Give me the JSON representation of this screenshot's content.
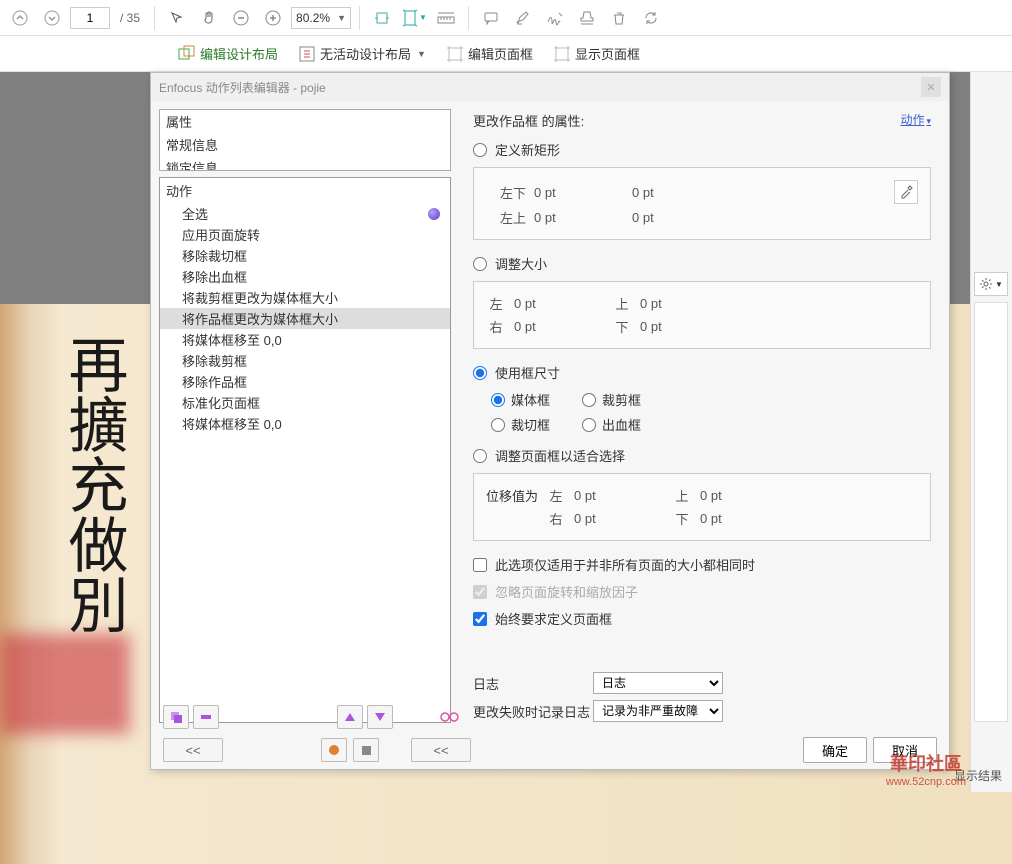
{
  "toolbar": {
    "page_current": "1",
    "page_total": "/ 35",
    "zoom": "80.2%"
  },
  "secondbar": {
    "edit_layout": "编辑设计布局",
    "no_active": "无活动设计布局",
    "edit_frame": "编辑页面框",
    "show_frame": "显示页面框"
  },
  "dialog": {
    "title": "Enfocus 动作列表编辑器 - pojie",
    "properties": [
      "属性",
      "常规信息",
      "锁定信息"
    ],
    "action_header": "动作",
    "actions": [
      "全选",
      "应用页面旋转",
      "移除裁切框",
      "移除出血框",
      "将裁剪框更改为媒体框大小",
      "将作品框更改为媒体框大小",
      "将媒体框移至 0,0",
      "移除裁剪框",
      "移除作品框",
      "标准化页面框",
      "将媒体框移至 0,0"
    ],
    "selected_action": 5,
    "right": {
      "section_title": "更改作品框 的属性:",
      "action_link": "动作",
      "opt_define": "定义新矩形",
      "left_bottom": "左下",
      "lb_val": "0 pt",
      "lb_val2": "0 pt",
      "left_top": "左上",
      "lt_val": "0 pt",
      "lt_val2": "0 pt",
      "opt_resize": "调整大小",
      "left": "左",
      "l_val": "0 pt",
      "top": "上",
      "t_val": "0 pt",
      "right_lbl": "右",
      "r_val": "0 pt",
      "bottom": "下",
      "b_val": "0 pt",
      "opt_useframe": "使用框尺寸",
      "media_frame": "媒体框",
      "crop_frame": "裁剪框",
      "trim_frame": "裁切框",
      "bleed_frame": "出血框",
      "opt_adjust": "调整页面框以适合选择",
      "offset_label": "位移值为",
      "off_left": "左",
      "off_l_val": "0 pt",
      "off_top": "上",
      "off_t_val": "0 pt",
      "off_right": "右",
      "off_r_val": "0 pt",
      "off_bottom": "下",
      "off_b_val": "0 pt",
      "chk_diff": "此选项仅适用于并非所有页面的大小都相同时",
      "chk_ignore": "忽略页面旋转和缩放因子",
      "chk_always": "始终要求定义页面框",
      "log_label": "日志",
      "log_select": "日志",
      "fail_label": "更改失败时记录日志",
      "fail_select": "记录为非严重故障"
    },
    "buttons": {
      "ok": "确定",
      "cancel": "取消",
      "back": "<<"
    }
  },
  "right_footer": "显示结果",
  "watermark": {
    "title": "華印社區",
    "url": "www.52cnp.com"
  }
}
